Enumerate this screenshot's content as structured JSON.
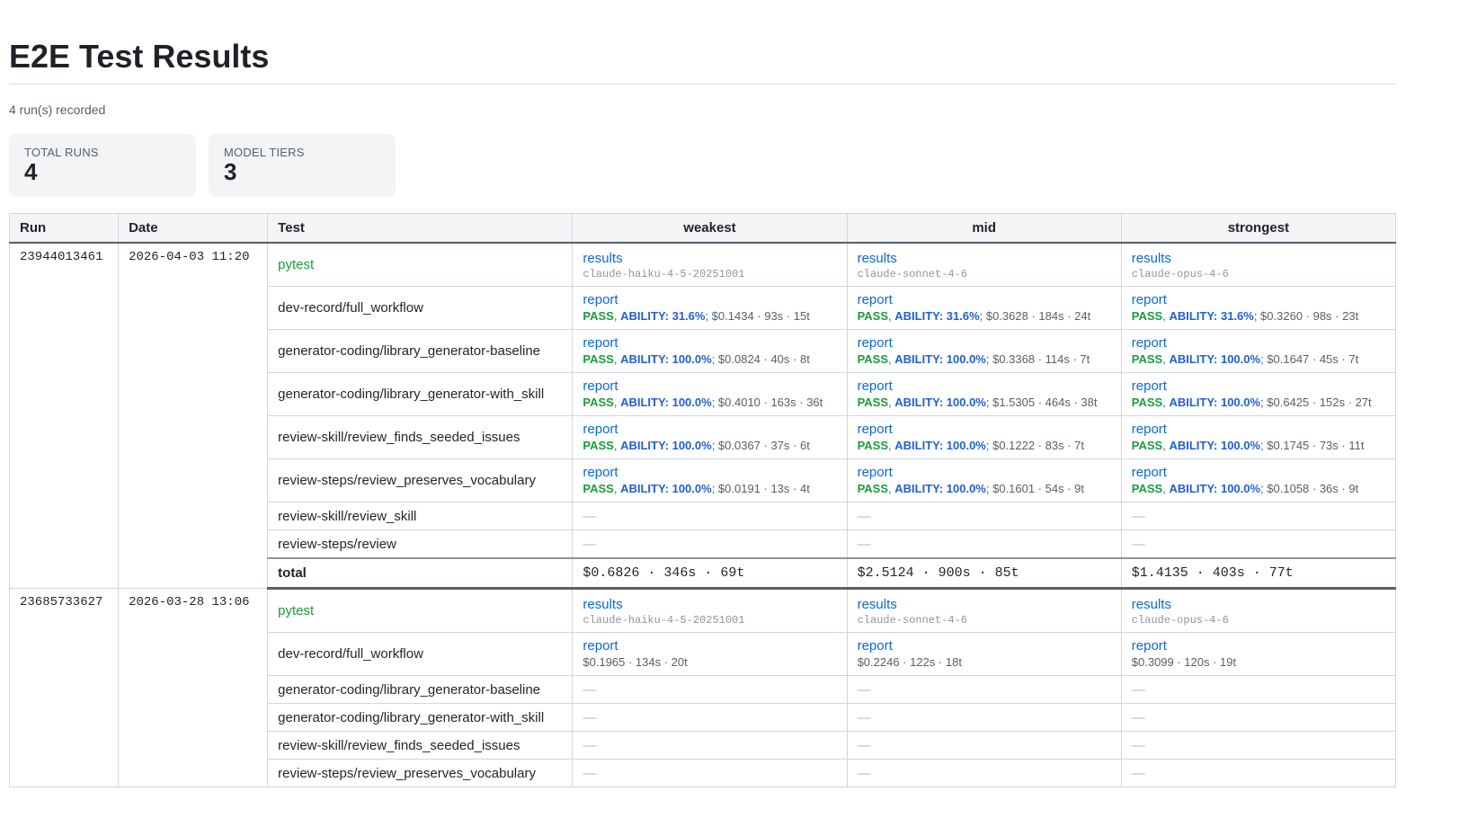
{
  "page": {
    "title": "E2E Test Results",
    "subtitle": "4 run(s) recorded"
  },
  "cards": [
    {
      "label": "TOTAL RUNS",
      "value": "4"
    },
    {
      "label": "MODEL TIERS",
      "value": "3"
    }
  ],
  "table": {
    "headers": {
      "run": "Run",
      "date": "Date",
      "test": "Test",
      "tiers": [
        "weakest",
        "mid",
        "strongest"
      ]
    },
    "dash": "—",
    "total_label": "total",
    "runs": [
      {
        "run": "23944013461",
        "date": "2026-04-03 11:20",
        "rows": [
          {
            "test": "pytest",
            "kind": "pytest",
            "cells": [
              {
                "link": "results",
                "model": "claude-haiku-4-5-20251001"
              },
              {
                "link": "results",
                "model": "claude-sonnet-4-6"
              },
              {
                "link": "results",
                "model": "claude-opus-4-6"
              }
            ]
          },
          {
            "test": "dev-record/full_workflow",
            "cells": [
              {
                "link": "report",
                "pass": "PASS",
                "ability": "ABILITY: 31.6%",
                "meta": "; $0.1434 · 93s · 15t"
              },
              {
                "link": "report",
                "pass": "PASS",
                "ability": "ABILITY: 31.6%",
                "meta": "; $0.3628 · 184s · 24t"
              },
              {
                "link": "report",
                "pass": "PASS",
                "ability": "ABILITY: 31.6%",
                "meta": "; $0.3260 · 98s · 23t"
              }
            ]
          },
          {
            "test": "generator-coding/library_generator-baseline",
            "cells": [
              {
                "link": "report",
                "pass": "PASS",
                "ability": "ABILITY: 100.0%",
                "meta": "; $0.0824 · 40s · 8t"
              },
              {
                "link": "report",
                "pass": "PASS",
                "ability": "ABILITY: 100.0%",
                "meta": "; $0.3368 · 114s · 7t"
              },
              {
                "link": "report",
                "pass": "PASS",
                "ability": "ABILITY: 100.0%",
                "meta": "; $0.1647 · 45s · 7t"
              }
            ]
          },
          {
            "test": "generator-coding/library_generator-with_skill",
            "cells": [
              {
                "link": "report",
                "pass": "PASS",
                "ability": "ABILITY: 100.0%",
                "meta": "; $0.4010 · 163s · 36t"
              },
              {
                "link": "report",
                "pass": "PASS",
                "ability": "ABILITY: 100.0%",
                "meta": "; $1.5305 · 464s · 38t"
              },
              {
                "link": "report",
                "pass": "PASS",
                "ability": "ABILITY: 100.0%",
                "meta": "; $0.6425 · 152s · 27t"
              }
            ]
          },
          {
            "test": "review-skill/review_finds_seeded_issues",
            "cells": [
              {
                "link": "report",
                "pass": "PASS",
                "ability": "ABILITY: 100.0%",
                "meta": "; $0.0367 · 37s · 6t"
              },
              {
                "link": "report",
                "pass": "PASS",
                "ability": "ABILITY: 100.0%",
                "meta": "; $0.1222 · 83s · 7t"
              },
              {
                "link": "report",
                "pass": "PASS",
                "ability": "ABILITY: 100.0%",
                "meta": "; $0.1745 · 73s · 11t"
              }
            ]
          },
          {
            "test": "review-steps/review_preserves_vocabulary",
            "cells": [
              {
                "link": "report",
                "pass": "PASS",
                "ability": "ABILITY: 100.0%",
                "meta": "; $0.0191 · 13s · 4t"
              },
              {
                "link": "report",
                "pass": "PASS",
                "ability": "ABILITY: 100.0%",
                "meta": "; $0.1601 · 54s · 9t"
              },
              {
                "link": "report",
                "pass": "PASS",
                "ability": "ABILITY: 100.0%",
                "meta": "; $0.1058 · 36s · 9t"
              }
            ]
          },
          {
            "test": "review-skill/review_skill",
            "cells": [
              null,
              null,
              null
            ]
          },
          {
            "test": "review-steps/review",
            "cells": [
              null,
              null,
              null
            ]
          }
        ],
        "totals": [
          "$0.6826 · 346s · 69t",
          "$2.5124 · 900s · 85t",
          "$1.4135 · 403s · 77t"
        ]
      },
      {
        "run": "23685733627",
        "date": "2026-03-28 13:06",
        "rows": [
          {
            "test": "pytest",
            "kind": "pytest",
            "cells": [
              {
                "link": "results",
                "model": "claude-haiku-4-5-20251001"
              },
              {
                "link": "results",
                "model": "claude-sonnet-4-6"
              },
              {
                "link": "results",
                "model": "claude-opus-4-6"
              }
            ]
          },
          {
            "test": "dev-record/full_workflow",
            "cells": [
              {
                "link": "report",
                "meta": "$0.1965 · 134s · 20t"
              },
              {
                "link": "report",
                "meta": "$0.2246 · 122s · 18t"
              },
              {
                "link": "report",
                "meta": "$0.3099 · 120s · 19t"
              }
            ]
          },
          {
            "test": "generator-coding/library_generator-baseline",
            "cells": [
              null,
              null,
              null
            ]
          },
          {
            "test": "generator-coding/library_generator-with_skill",
            "cells": [
              null,
              null,
              null
            ]
          },
          {
            "test": "review-skill/review_finds_seeded_issues",
            "cells": [
              null,
              null,
              null
            ]
          },
          {
            "test": "review-steps/review_preserves_vocabulary",
            "cells": [
              null,
              null,
              null
            ]
          }
        ],
        "totals": null
      }
    ]
  }
}
